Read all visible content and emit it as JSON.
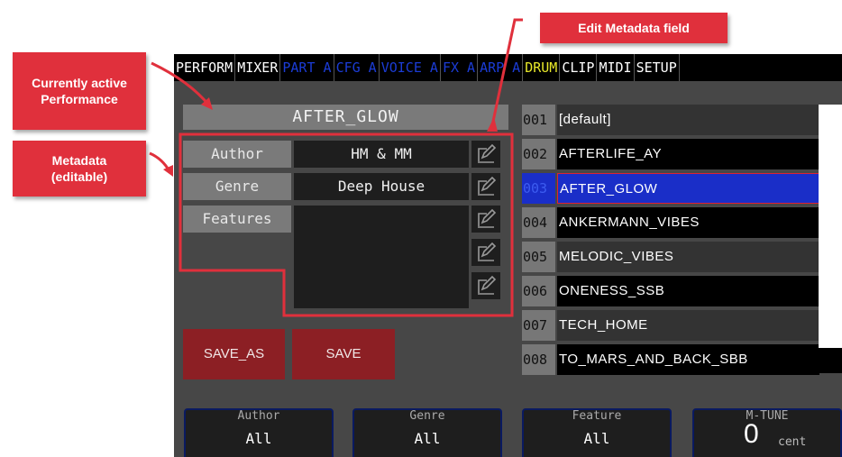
{
  "annotations": {
    "edit_metadata": "Edit Metadata field",
    "active_performance": "Currently active Performance",
    "metadata": "Metadata (editable)"
  },
  "tabs": [
    {
      "label": "PERFORM",
      "style": "active"
    },
    {
      "label": "MIXER",
      "style": "active"
    },
    {
      "label": "PART A",
      "style": "dim"
    },
    {
      "label": "CFG A",
      "style": "dim"
    },
    {
      "label": "VOICE A",
      "style": "dim"
    },
    {
      "label": "FX A",
      "style": "dim"
    },
    {
      "label": "ARP A",
      "style": "dim"
    },
    {
      "label": "DRUM",
      "style": "yellow"
    },
    {
      "label": "CLIP",
      "style": "active"
    },
    {
      "label": "MIDI",
      "style": "active"
    },
    {
      "label": "SETUP",
      "style": "active"
    }
  ],
  "performance_title": "AFTER_GLOW",
  "metadata": {
    "author_label": "Author",
    "author_value": "HM & MM",
    "genre_label": "Genre",
    "genre_value": "Deep House",
    "features_label": "Features",
    "features_value": ""
  },
  "buttons": {
    "save_as": "SAVE_AS",
    "save": "SAVE"
  },
  "performances": [
    {
      "num": "001",
      "name": "[default]",
      "selected": false
    },
    {
      "num": "002",
      "name": "AFTERLIFE_AY",
      "selected": false
    },
    {
      "num": "003",
      "name": "AFTER_GLOW",
      "selected": true
    },
    {
      "num": "004",
      "name": "ANKERMANN_VIBES",
      "selected": false
    },
    {
      "num": "005",
      "name": "MELODIC_VIBES",
      "selected": false
    },
    {
      "num": "006",
      "name": "ONENESS_SSB",
      "selected": false
    },
    {
      "num": "007",
      "name": "TECH_HOME",
      "selected": false
    },
    {
      "num": "008",
      "name": "TO_MARS_AND_BACK_SBB",
      "selected": false
    }
  ],
  "filters": [
    {
      "label": "Author",
      "value": "All"
    },
    {
      "label": "Genre",
      "value": "All"
    },
    {
      "label": "Feature",
      "value": "All"
    }
  ],
  "mtune": {
    "label": "M-TUNE",
    "value": "0",
    "unit": "cent"
  },
  "colors": {
    "accent_red": "#e0303c",
    "selection_blue": "#1a2ec8",
    "button_red": "#8c1f24"
  }
}
